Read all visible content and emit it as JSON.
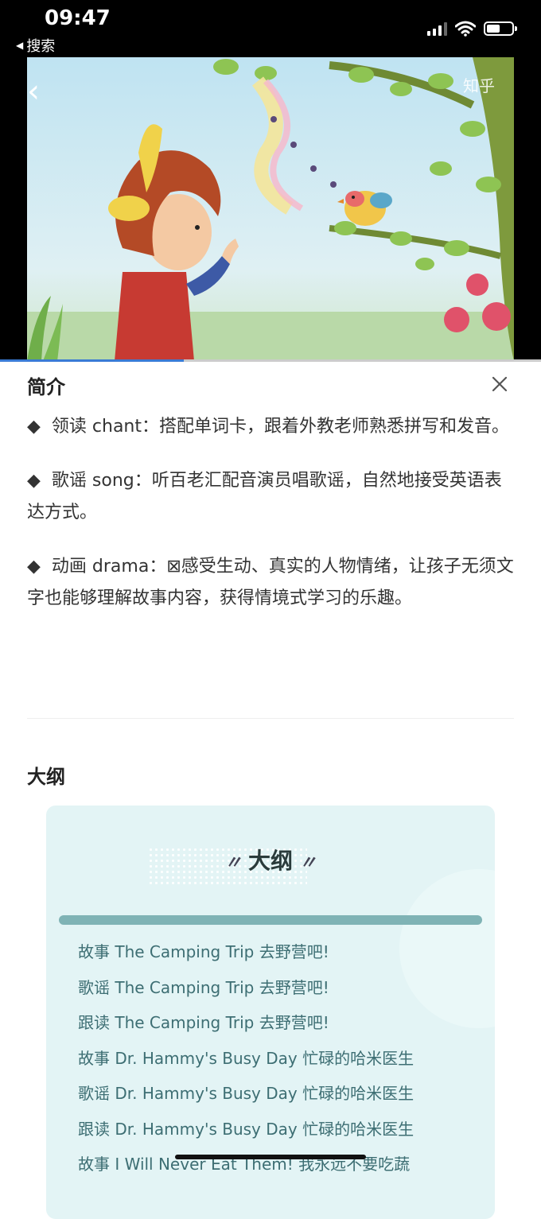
{
  "status_bar": {
    "time": "09:47",
    "back_app_label": "搜索"
  },
  "video": {
    "watermark": "知乎",
    "progress_fraction": 0.34
  },
  "intro": {
    "title": "简介",
    "paragraphs": [
      "领读 chant：搭配单词卡，跟着外教老师熟悉拼写和发音。",
      "歌谣 song：听百老汇配音演员唱歌谣，自然地接受英语表达方式。",
      "动画 drama：⊠感受生动、真实的人物情绪，让孩子无须文字也能够理解故事内容，获得情境式学习的乐趣。"
    ],
    "bullet": "◆"
  },
  "outline": {
    "heading": "大纲",
    "card_title": "大纲",
    "items": [
      "故事 The Camping Trip 去野营吧!",
      "歌谣 The Camping Trip 去野营吧!",
      "跟读 The Camping Trip 去野营吧!",
      "故事 Dr. Hammy's Busy Day 忙碌的哈米医生",
      "歌谣 Dr. Hammy's Busy Day 忙碌的哈米医生",
      "跟读 Dr. Hammy's Busy Day 忙碌的哈米医生",
      "故事 I Will Never Eat Them! 我永远不要吃蔬"
    ]
  },
  "icons": {
    "back": "chevron-left-icon",
    "close": "close-icon",
    "signal": "cellular-signal-icon",
    "wifi": "wifi-icon",
    "battery": "battery-icon"
  },
  "colors": {
    "card_bg": "#e3f4f5",
    "card_bar": "#7fb3b5",
    "outline_text": "#3d6e73",
    "progress": "#3a7bd5"
  }
}
